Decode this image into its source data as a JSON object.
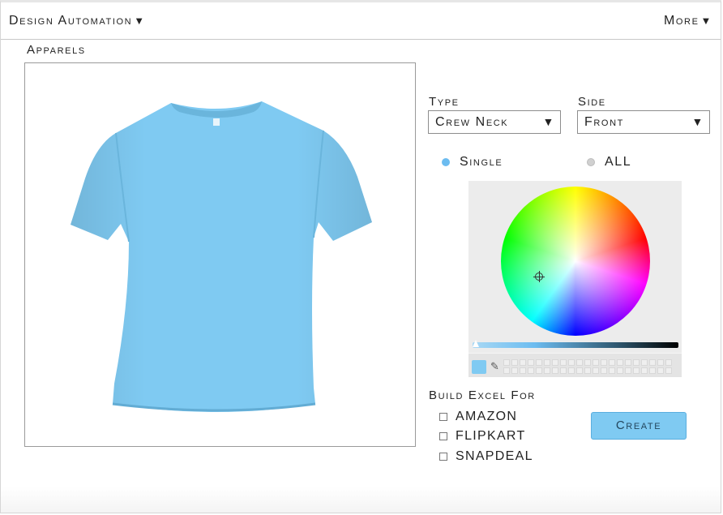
{
  "nav": {
    "title": "Design Automation",
    "more": "More",
    "caret": "▼"
  },
  "section_label": "Apparels",
  "preview": {
    "shirt_color": "#7fcaf2"
  },
  "type_select": {
    "label": "Type",
    "value": "Crew Neck",
    "arrow": "▼"
  },
  "side_select": {
    "label": "Side",
    "value": "Front",
    "arrow": "▼"
  },
  "color_mode": {
    "single": {
      "label": "Single",
      "selected": true
    },
    "all": {
      "label": "ALL",
      "selected": false
    }
  },
  "color_picker": {
    "current_color": "#7fcaf2",
    "eyedropper_icon": "eyedropper-icon"
  },
  "build_excel": {
    "label": "Build Excel For",
    "options": [
      {
        "label": "AMAZON",
        "checked": false
      },
      {
        "label": "FLIPKART",
        "checked": false
      },
      {
        "label": "SNAPDEAL",
        "checked": false
      }
    ]
  },
  "create_button": {
    "label": "Create"
  },
  "colors": {
    "accent": "#7fcaf2",
    "radio_on": "#6cbcf0"
  }
}
